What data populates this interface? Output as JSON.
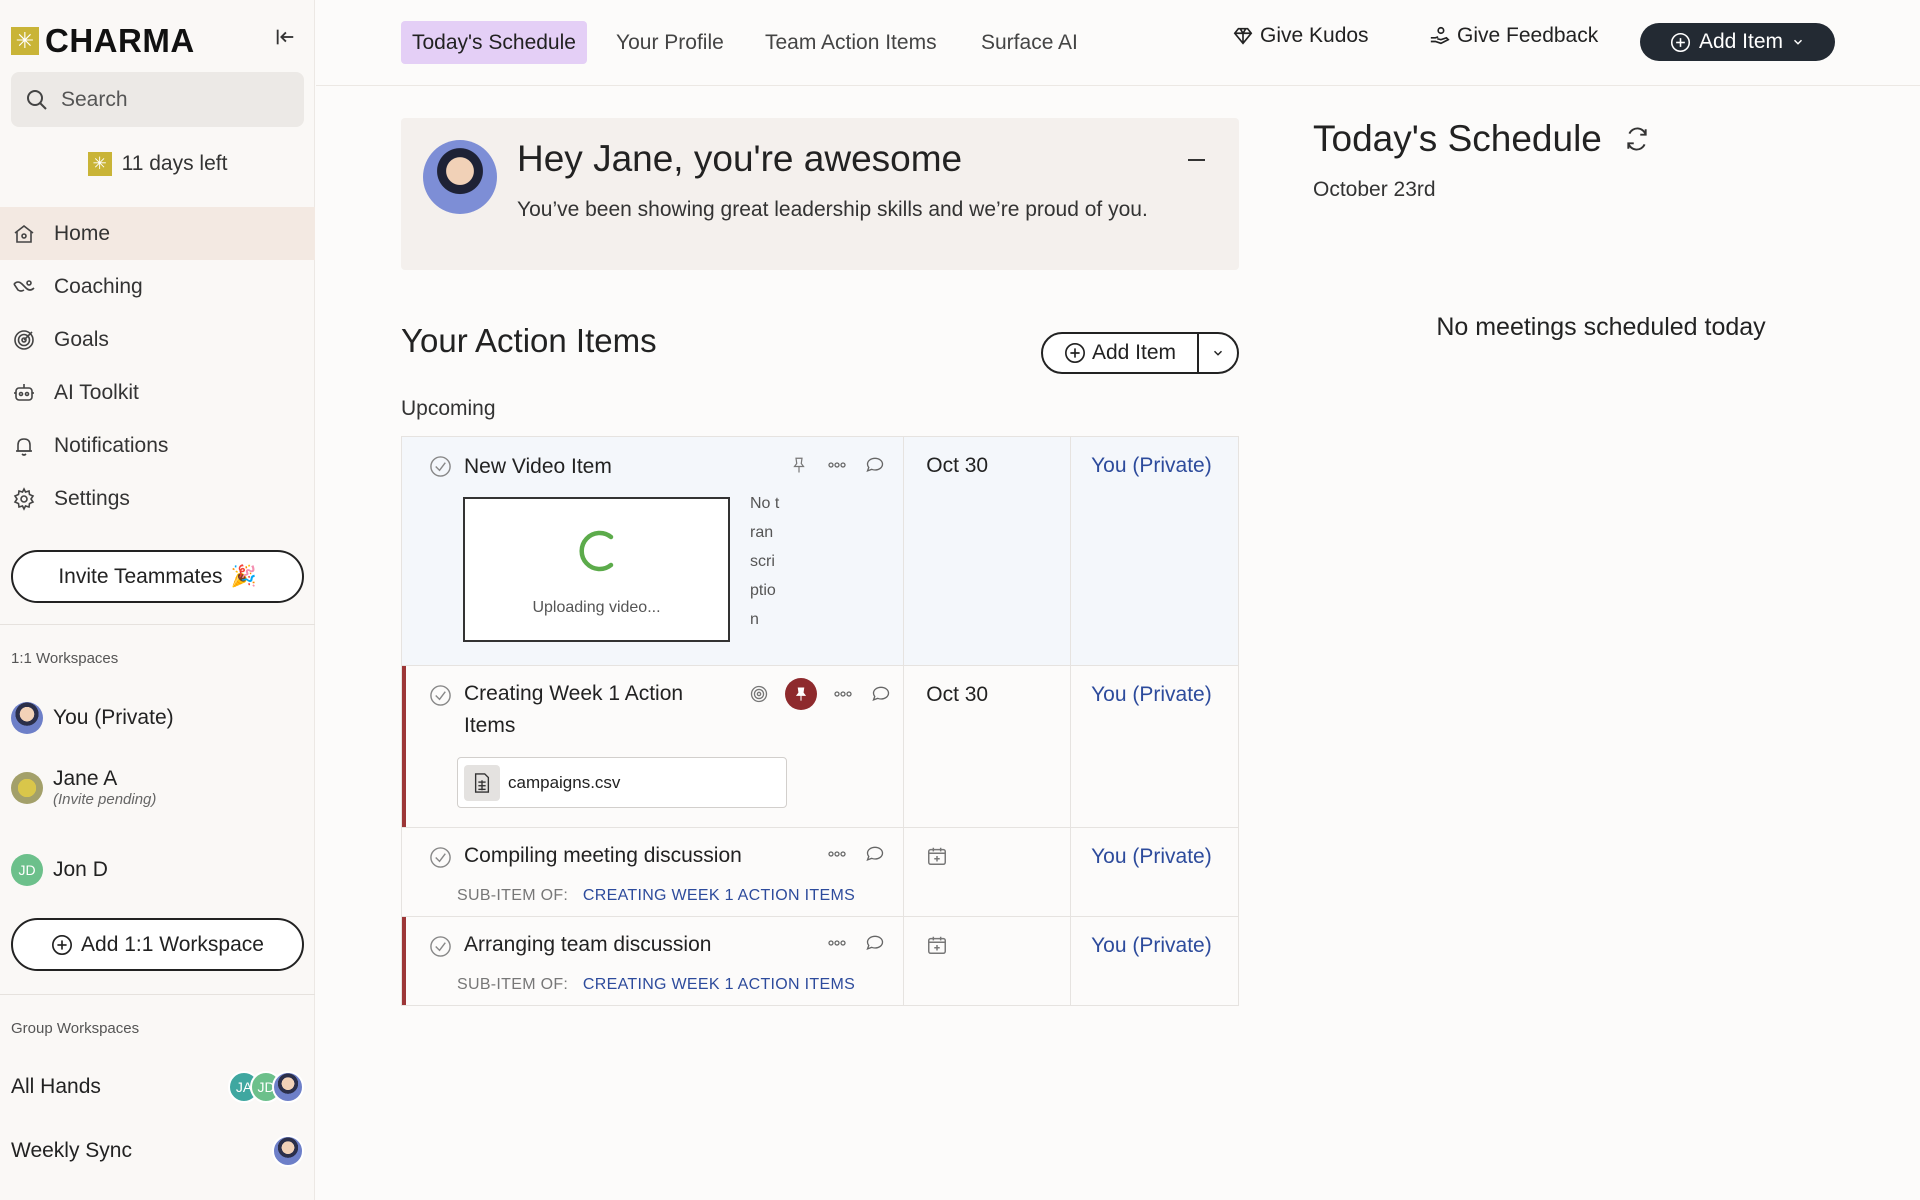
{
  "app": {
    "logo_text": "CHARMA",
    "trial_text": "11 days left"
  },
  "search": {
    "placeholder": "Search"
  },
  "sidebar": {
    "nav": [
      {
        "label": "Home",
        "icon": "home-icon"
      },
      {
        "label": "Coaching",
        "icon": "coaching-icon"
      },
      {
        "label": "Goals",
        "icon": "target-icon"
      },
      {
        "label": "AI Toolkit",
        "icon": "robot-icon"
      },
      {
        "label": "Notifications",
        "icon": "bell-icon"
      },
      {
        "label": "Settings",
        "icon": "gear-icon"
      }
    ],
    "invite_label": "Invite Teammates",
    "one_on_one_label": "1:1 Workspaces",
    "workspaces": [
      {
        "name": "You (Private)"
      },
      {
        "name": "Jane A",
        "sub": "(Invite pending)"
      },
      {
        "name": "Jon D",
        "initials": "JD"
      }
    ],
    "add_workspace_label": "Add 1:1 Workspace",
    "group_label": "Group Workspaces",
    "groups": [
      {
        "name": "All Hands",
        "initials": [
          "JA",
          "JD"
        ]
      },
      {
        "name": "Weekly Sync"
      }
    ]
  },
  "topbar": {
    "tabs": [
      "Today's Schedule",
      "Your Profile",
      "Team Action Items",
      "Surface AI"
    ],
    "give_kudos": "Give Kudos",
    "give_feedback": "Give Feedback",
    "add_item": "Add Item"
  },
  "greeting": {
    "title": "Hey Jane, you're awesome",
    "subtitle": "You’ve been showing great leadership skills and we’re proud of you."
  },
  "action_items": {
    "title": "Your Action Items",
    "add_label": "Add Item",
    "section": "Upcoming",
    "items": [
      {
        "title": "New Video Item",
        "date": "Oct 30",
        "owner": "You (Private)",
        "video_status": "Uploading video...",
        "transcript": "No transcription"
      },
      {
        "title": "Creating Week 1 Action Items",
        "date": "Oct 30",
        "owner": "You (Private)",
        "attachment": "campaigns.csv"
      },
      {
        "title": "Compiling meeting discussion",
        "date": "",
        "owner": "You (Private)",
        "sub_label": "SUB-ITEM OF:",
        "parent": "CREATING WEEK 1 ACTION ITEMS"
      },
      {
        "title": "Arranging team discussion",
        "date": "",
        "owner": "You (Private)",
        "sub_label": "SUB-ITEM OF:",
        "parent": "CREATING WEEK 1 ACTION ITEMS"
      }
    ]
  },
  "schedule": {
    "title": "Today's Schedule",
    "date": "October 23rd",
    "empty": "No meetings scheduled today"
  },
  "colors": {
    "brand_yellow": "#c9b437",
    "active_tab": "#e4cff6",
    "link_blue": "#2d4b9c",
    "flag_red": "#9c3637",
    "dark_button": "#232a33"
  }
}
